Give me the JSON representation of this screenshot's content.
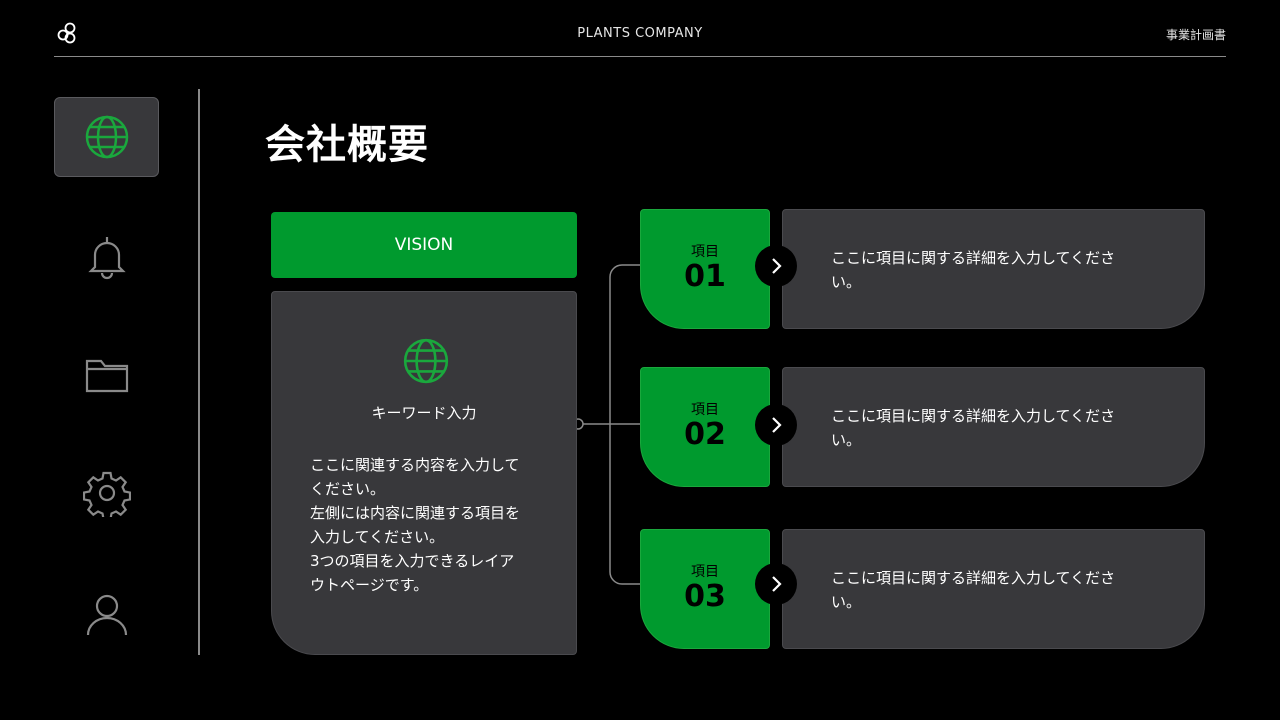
{
  "header": {
    "company": "PLANTS COMPANY",
    "doc_type": "事業計画書"
  },
  "sidebar": {
    "items": [
      {
        "name": "globe",
        "active": true
      },
      {
        "name": "bell",
        "active": false
      },
      {
        "name": "folder",
        "active": false
      },
      {
        "name": "gear",
        "active": false
      },
      {
        "name": "user",
        "active": false
      }
    ]
  },
  "page": {
    "title": "会社概要"
  },
  "vision": {
    "label": "VISION",
    "keyword": "キーワード入力",
    "description": "ここに関連する内容を入力して\nください。\n左側には内容に関連する項目を\n入力してください。\n3つの項目を入力できるレイア\nウトページです。"
  },
  "items": [
    {
      "label": "項目",
      "number": "01",
      "detail": "ここに項目に関する詳細を入力してください。"
    },
    {
      "label": "項目",
      "number": "02",
      "detail": "ここに項目に関する詳細を入力してください。"
    },
    {
      "label": "項目",
      "number": "03",
      "detail": "ここに項目に関する詳細を入力してください。"
    }
  ],
  "colors": {
    "accent": "#009a2e",
    "card": "#38383b",
    "background": "#000000",
    "icon_active": "#1aa83d",
    "icon_inactive": "#8a8a8a"
  }
}
